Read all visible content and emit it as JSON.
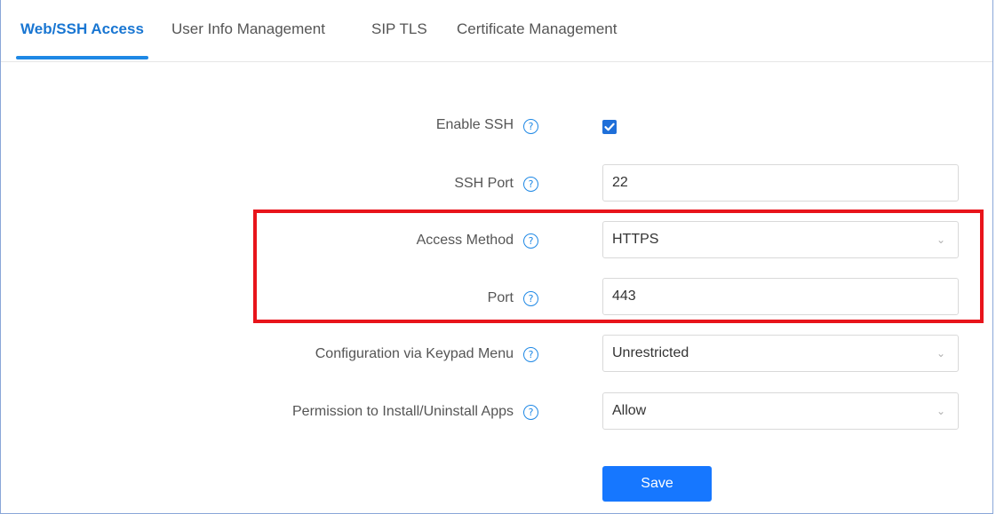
{
  "tabs": [
    {
      "label": "Web/SSH Access",
      "active": true
    },
    {
      "label": "User Info Management",
      "active": false
    },
    {
      "label": "SIP TLS",
      "active": false
    },
    {
      "label": "Certificate Management",
      "active": false
    }
  ],
  "form": {
    "enable_ssh": {
      "label": "Enable SSH",
      "checked": true
    },
    "ssh_port": {
      "label": "SSH Port",
      "value": "22"
    },
    "access_method": {
      "label": "Access Method",
      "value": "HTTPS"
    },
    "port": {
      "label": "Port",
      "value": "443"
    },
    "config_keypad": {
      "label": "Configuration via Keypad Menu",
      "value": "Unrestricted"
    },
    "install_apps": {
      "label": "Permission to Install/Uninstall Apps",
      "value": "Allow"
    },
    "help_glyph": "?",
    "save_label": "Save"
  },
  "colors": {
    "accent": "#1e88e5",
    "highlight_box": "#e8141b",
    "save_button": "#1677ff"
  }
}
